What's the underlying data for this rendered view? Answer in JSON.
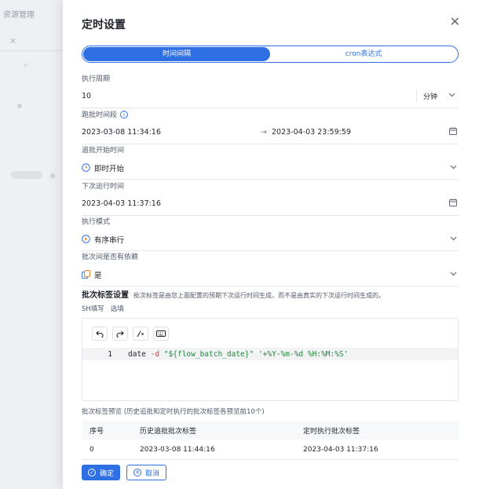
{
  "background": {
    "tab_label": "资源管理"
  },
  "drawer": {
    "title": "定时设置",
    "close_glyph": "✕"
  },
  "mode_tabs": [
    {
      "label": "时间间隔",
      "active": true
    },
    {
      "label": "cron表达式",
      "active": false
    }
  ],
  "cycle": {
    "label": "执行周期",
    "value": "10",
    "unit": "分钟"
  },
  "batch_range": {
    "label": "跑批时间段",
    "start": "2023-03-08 11:34:16",
    "arrow": "→",
    "end": "2023-04-03 23:59:59"
  },
  "catchup_start": {
    "label": "追批开始时间",
    "value": "即时开始"
  },
  "next_run": {
    "label": "下次运行时间",
    "value": "2023-04-03 11:37:16"
  },
  "exec_mode": {
    "label": "执行模式",
    "value": "有序串行"
  },
  "batch_dependency": {
    "label": "批次间是否有依赖",
    "value": "是"
  },
  "batch_tag": {
    "heading": "批次标签设置",
    "description": "批次标签是由您上面配置的预期下次运行时间生成，而不是由真实的下次运行时间生成的。",
    "sub_tabs": [
      "SH填写",
      "选填"
    ],
    "line_number": "1",
    "code": {
      "cmd": "date",
      "flag": "-d",
      "arg1": "\"${flow_batch_date}\"",
      "arg2": "'+%Y-%m-%d %H:%M:%S'"
    }
  },
  "preview": {
    "label": "批次标签预览 (历史追批和定时执行的批次标签各预览前10个)",
    "headers": [
      "序号",
      "历史追批批次标签",
      "定时执行批次标签"
    ],
    "rows": [
      [
        "0",
        "2023-03-08 11:44:16",
        "2023-04-03 11:37:16"
      ]
    ]
  },
  "footer": {
    "confirm": "确定",
    "cancel": "取消"
  },
  "colors": {
    "accent": "#2f6fe4",
    "clock_icon": "#2f6fe4",
    "exec_icon": "#e67e22",
    "dep_icon": "#e67e22"
  }
}
